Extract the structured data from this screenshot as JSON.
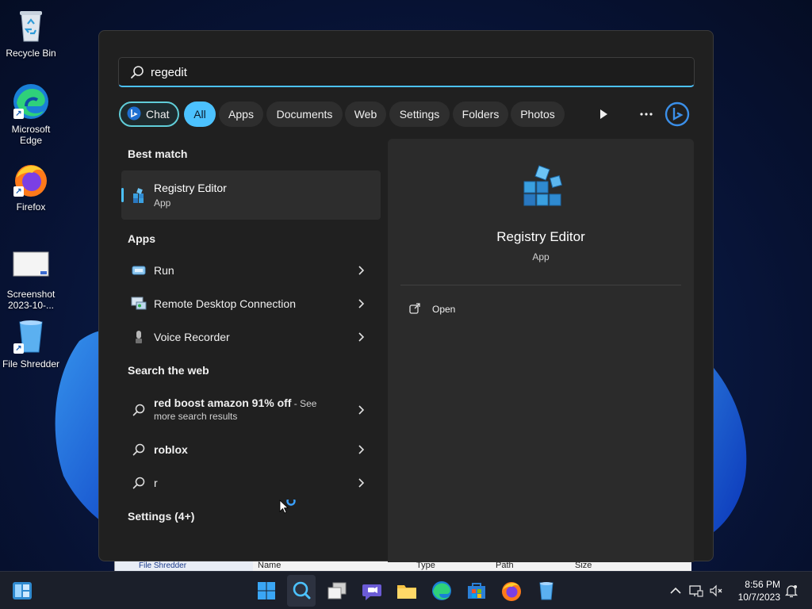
{
  "desktop": {
    "icons": [
      {
        "label_line1": "Recycle Bin",
        "label_line2": ""
      },
      {
        "label_line1": "Microsoft",
        "label_line2": "Edge"
      },
      {
        "label_line1": "Firefox",
        "label_line2": ""
      },
      {
        "label_line1": "Screenshot",
        "label_line2": "2023-10-..."
      },
      {
        "label_line1": "File Shredder",
        "label_line2": ""
      }
    ]
  },
  "background_window": {
    "nav_item": "File Shredder",
    "columns": [
      "Name",
      "Type",
      "Path",
      "Size"
    ]
  },
  "search": {
    "query": "regedit",
    "filters": [
      {
        "label": "Chat",
        "active": false
      },
      {
        "label": "All",
        "active": true
      },
      {
        "label": "Apps",
        "active": false
      },
      {
        "label": "Documents",
        "active": false
      },
      {
        "label": "Web",
        "active": false
      },
      {
        "label": "Settings",
        "active": false
      },
      {
        "label": "Folders",
        "active": false
      },
      {
        "label": "Photos",
        "active": false
      }
    ],
    "best_match": {
      "section": "Best match",
      "name": "Registry Editor",
      "type": "App"
    },
    "apps": {
      "section": "Apps",
      "items": [
        "Run",
        "Remote Desktop Connection",
        "Voice Recorder"
      ]
    },
    "web": {
      "section": "Search the web",
      "items": [
        {
          "bold": "red boost amazon 91% off",
          "suffix": " - See",
          "line2": "more search results"
        },
        {
          "bold": "roblox",
          "suffix": "",
          "line2": ""
        },
        {
          "bold": "",
          "suffix": "r",
          "line2": ""
        }
      ]
    },
    "settings_section": "Settings (4+)",
    "detail": {
      "name": "Registry Editor",
      "type": "App",
      "action": "Open"
    }
  },
  "taskbar": {
    "clock_time": "8:56 PM",
    "clock_date": "10/7/2023"
  },
  "colors": {
    "accent": "#4cc2ff",
    "chat_border": "#60cdd8",
    "flyout_bg": "#202020",
    "detail_bg": "#2b2b2b"
  }
}
